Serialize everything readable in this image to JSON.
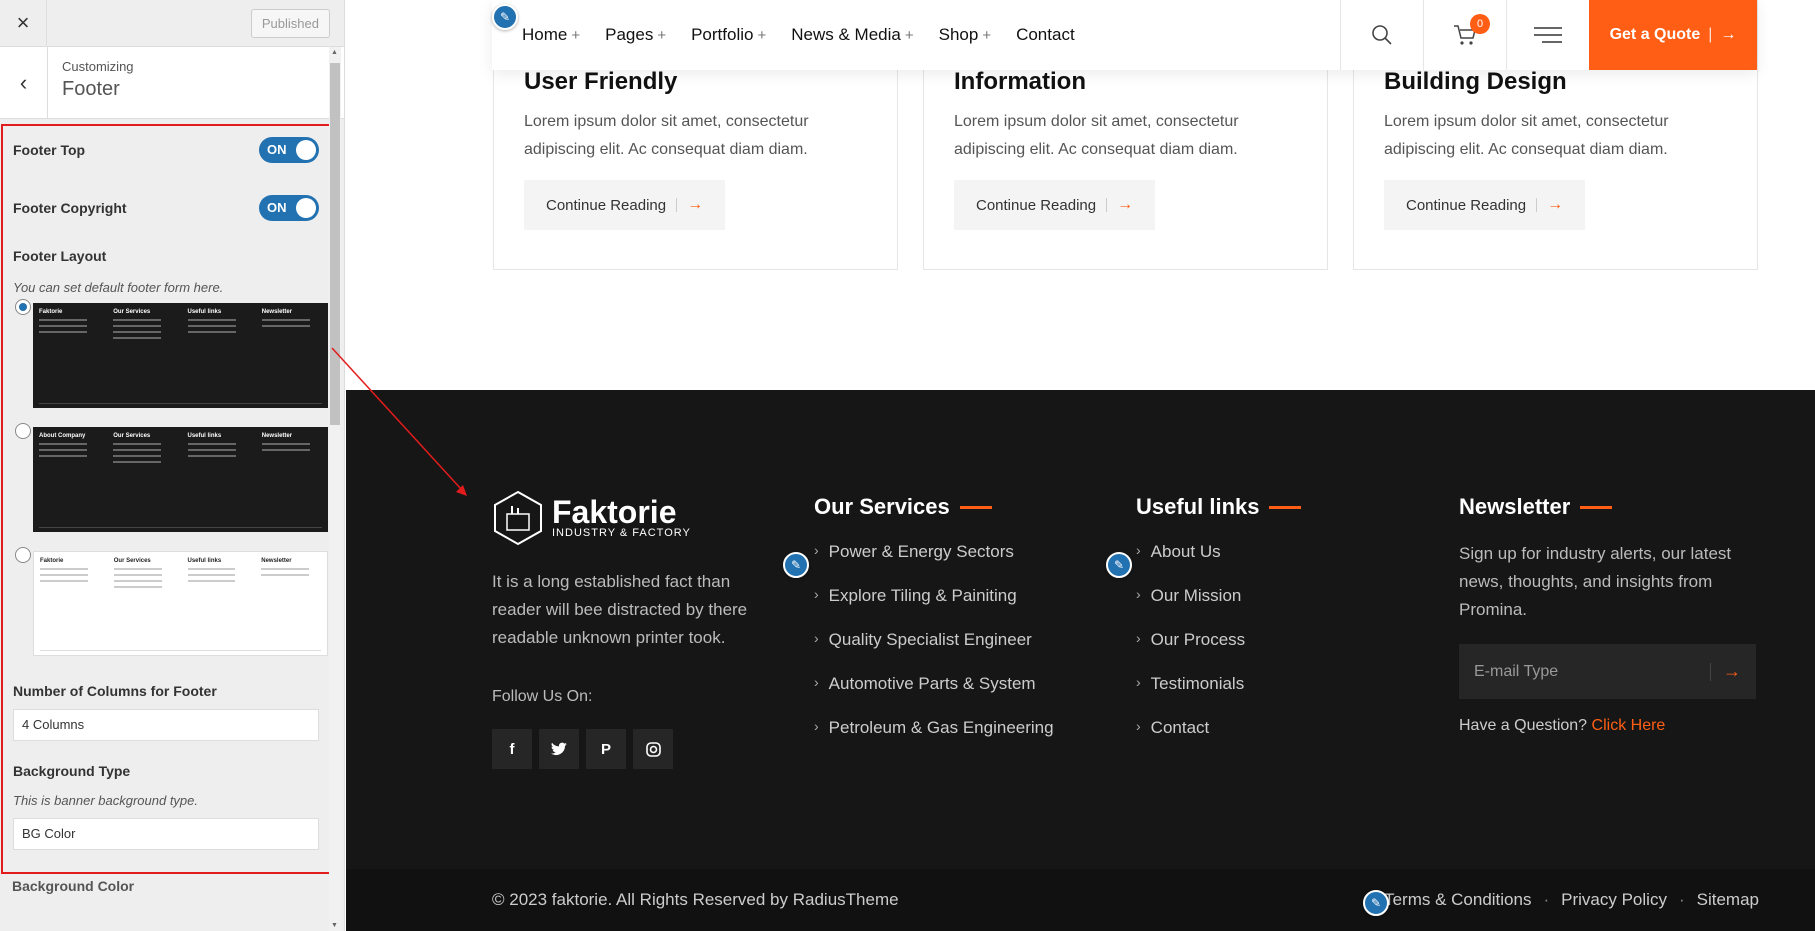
{
  "customizer": {
    "close_label": "×",
    "published_label": "Published",
    "back_label": "‹",
    "context_label": "Customizing",
    "section_title": "Footer",
    "footer_top_label": "Footer Top",
    "footer_top_state": "ON",
    "footer_copyright_label": "Footer Copyright",
    "footer_copyright_state": "ON",
    "footer_layout_label": "Footer Layout",
    "footer_layout_hint": "You can set default footer form here.",
    "layout_selected": 1,
    "columns_label": "Number of Columns for Footer",
    "columns_value": "4 Columns",
    "bg_type_label": "Background Type",
    "bg_type_hint": "This is banner background type.",
    "bg_type_value": "BG Color",
    "next_label": "Background Color"
  },
  "header": {
    "nav": [
      {
        "label": "Home",
        "plus": "+"
      },
      {
        "label": "Pages",
        "plus": "+"
      },
      {
        "label": "Portfolio",
        "plus": "+"
      },
      {
        "label": "News & Media",
        "plus": "+"
      },
      {
        "label": "Shop",
        "plus": "+"
      },
      {
        "label": "Contact",
        "plus": ""
      }
    ],
    "cart_count": "0",
    "quote_label": "Get a Quote"
  },
  "cards": [
    {
      "title": "User Friendly",
      "text": "Lorem ipsum dolor sit amet, consectetur adipiscing elit. Ac consequat diam diam.",
      "button": "Continue Reading"
    },
    {
      "title": "Information",
      "text": "Lorem ipsum dolor sit amet, consectetur adipiscing elit. Ac consequat diam diam.",
      "button": "Continue Reading"
    },
    {
      "title": "Building Design",
      "text": "Lorem ipsum dolor sit amet, consectetur adipiscing elit. Ac consequat diam diam.",
      "button": "Continue Reading"
    }
  ],
  "footer": {
    "brand_name": "Faktorie",
    "brand_tag": "INDUSTRY & FACTORY",
    "about": "It is a long established fact than reader will bee distracted by there readable unknown printer took.",
    "follow_label": "Follow Us On:",
    "services_title": "Our Services",
    "services": [
      "Power & Energy Sectors",
      "Explore Tiling & Painiting",
      "Quality Specialist Engineer",
      "Automotive Parts & System",
      "Petroleum & Gas Engineering"
    ],
    "links_title": "Useful links",
    "links": [
      "About Us",
      "Our Mission",
      "Our Process",
      "Testimonials",
      "Contact"
    ],
    "newsletter_title": "Newsletter",
    "newsletter_text": "Sign up for industry alerts, our latest news, thoughts, and insights from Promina.",
    "email_placeholder": "E-mail Type",
    "question": "Have a Question?",
    "question_link": "Click Here"
  },
  "copyright": {
    "text": "© 2023 faktorie. All Rights Reserved by RadiusTheme",
    "links": [
      "Terms & Conditions",
      "Privacy Policy",
      "Sitemap"
    ]
  },
  "colors": {
    "accent": "#ff5e14",
    "customizer_blue": "#2271b1",
    "annotation_red": "#e21c1c"
  }
}
